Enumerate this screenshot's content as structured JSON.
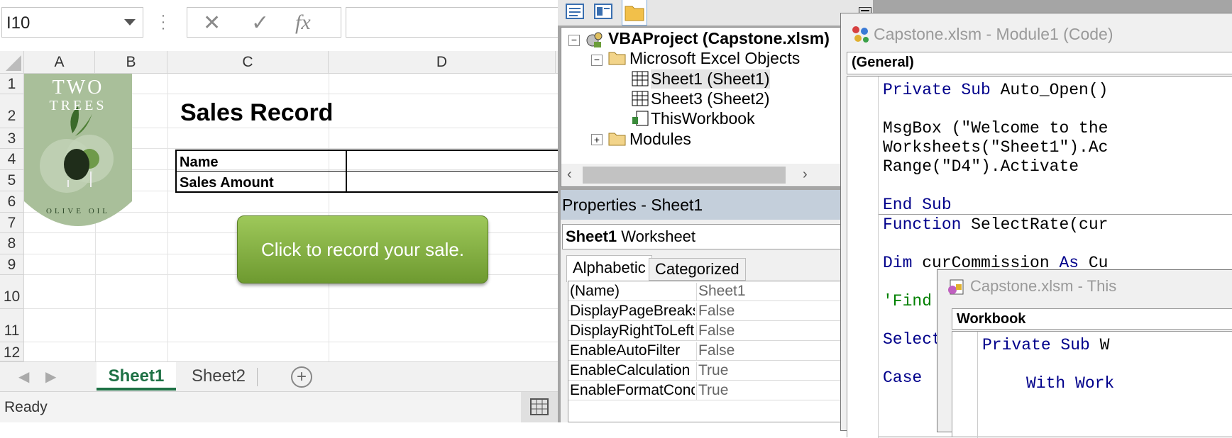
{
  "excel": {
    "name_box": "I10",
    "fx_label": "fx",
    "columns": [
      "A",
      "B",
      "C",
      "D"
    ],
    "rows": [
      "1",
      "2",
      "3",
      "4",
      "5",
      "6",
      "7",
      "8",
      "9",
      "10",
      "11",
      "12"
    ],
    "logo_top": "TWO",
    "logo_mid": "TREES",
    "logo_bottom": "OLIVE OIL",
    "title": "Sales Record",
    "table_labels": [
      "Name",
      "Sales Amount"
    ],
    "record_button": "Click to record your sale.",
    "sheet_tabs": [
      "Sheet1",
      "Sheet2"
    ],
    "add_sheet": "+",
    "status": "Ready"
  },
  "explorer": {
    "project": "VBAProject (Capstone.xlsm)",
    "folder_excel_objects": "Microsoft Excel Objects",
    "items": [
      "Sheet1 (Sheet1)",
      "Sheet3 (Sheet2)",
      "ThisWorkbook"
    ],
    "folder_modules": "Modules"
  },
  "properties": {
    "title": "Properties - Sheet1",
    "object_name": "Sheet1",
    "object_type": "Worksheet",
    "tabs": [
      "Alphabetic",
      "Categorized"
    ],
    "rows": [
      {
        "key": "(Name)",
        "value": "Sheet1"
      },
      {
        "key": "DisplayPageBreaks",
        "value": "False"
      },
      {
        "key": "DisplayRightToLeft",
        "value": "False"
      },
      {
        "key": "EnableAutoFilter",
        "value": "False"
      },
      {
        "key": "EnableCalculation",
        "value": "True"
      },
      {
        "key": "EnableFormatCondi",
        "value": "True"
      }
    ]
  },
  "code1": {
    "title": "Capstone.xlsm - Module1 (Code)",
    "combo": "(General)",
    "lines": {
      "l1_kw": "Private Sub",
      "l1_rest": " Auto_Open()",
      "l2": "MsgBox (\"Welcome to the",
      "l3": "Worksheets(\"Sheet1\").Ac",
      "l4": "Range(\"D4\").Activate",
      "l5_kw": "End Sub",
      "l6_kw": "Function",
      "l6_rest": " SelectRate(cur",
      "l7_kw": "Dim",
      "l7_mid": " curCommission ",
      "l7_kw2": "As",
      "l7_rest": " Cu",
      "l8": "'Find",
      "l9": "Select",
      "l10": "Case"
    }
  },
  "code2": {
    "title": "Capstone.xlsm - This",
    "combo": "Workbook",
    "line1_kw": "Private Sub",
    "line1_rest": " W",
    "line2": "With Work"
  },
  "colors": {
    "accent_green": "#1e7145",
    "button_green": "#7fac3f",
    "vba_keyword": "#00008b",
    "vba_comment": "#008000"
  }
}
